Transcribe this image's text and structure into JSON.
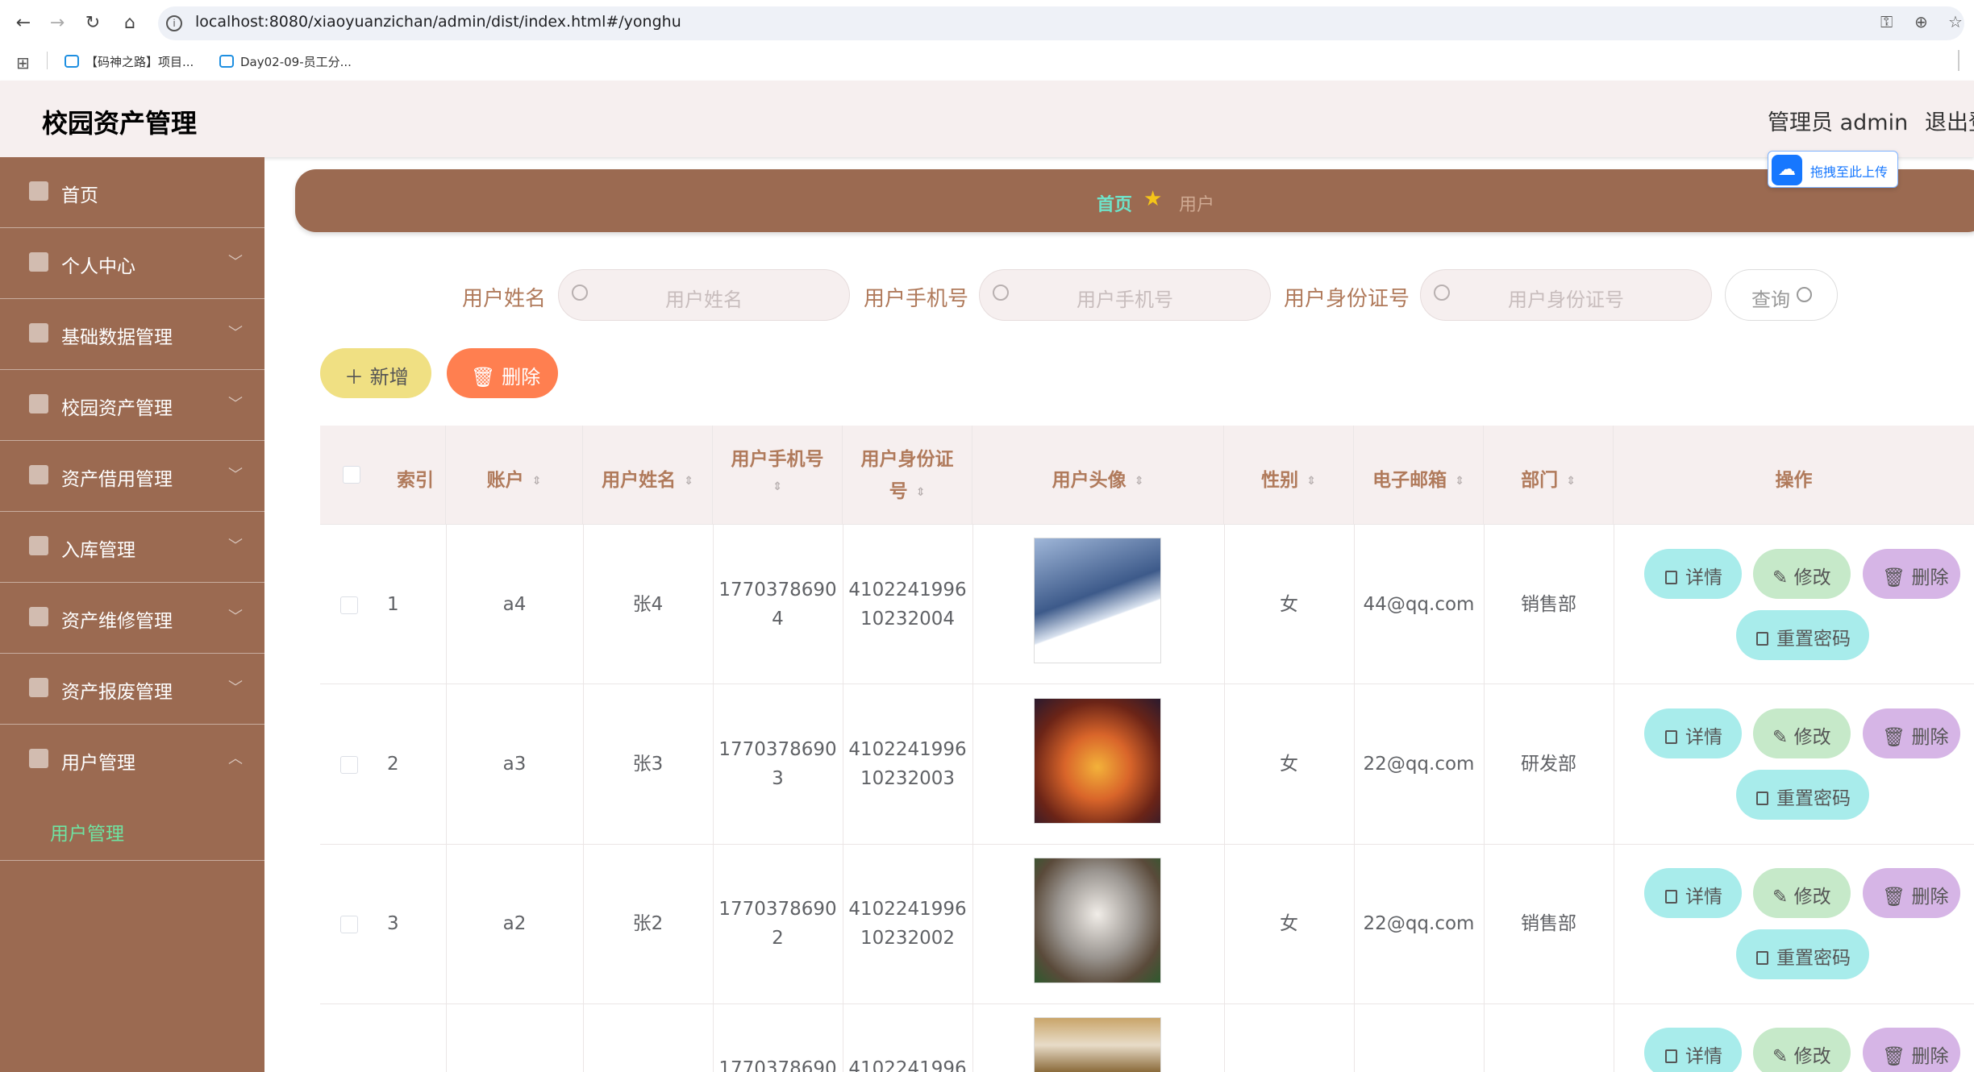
{
  "browser": {
    "url": "localhost:8080/xiaoyuanzichan/admin/dist/index.html#/yonghu",
    "bookmarks": [
      "【码神之路】项目...",
      "Day02-09-员工分..."
    ]
  },
  "header": {
    "title": "校园资产管理",
    "user": "管理员 admin",
    "logout": "退出登录"
  },
  "sidebar": {
    "items": [
      {
        "label": "首页"
      },
      {
        "label": "个人中心"
      },
      {
        "label": "基础数据管理"
      },
      {
        "label": "校园资产管理"
      },
      {
        "label": "资产借用管理"
      },
      {
        "label": "入库管理"
      },
      {
        "label": "资产维修管理"
      },
      {
        "label": "资产报废管理"
      },
      {
        "label": "用户管理"
      }
    ],
    "active_sub": "用户管理"
  },
  "breadcrumb": {
    "home": "首页",
    "current": "用户"
  },
  "upload_chip": "拖拽至此上传",
  "search": {
    "name_label": "用户姓名",
    "name_placeholder": "用户姓名",
    "phone_label": "用户手机号",
    "phone_placeholder": "用户手机号",
    "id_label": "用户身份证号",
    "id_placeholder": "用户身份证号",
    "query": "查询"
  },
  "toolbar": {
    "add": "新增",
    "delete": "删除"
  },
  "table": {
    "headers": {
      "index": "索引",
      "account": "账户",
      "name": "用户姓名",
      "phone_1": "用户手机号",
      "id_1": "用户身份证",
      "id_2": "号",
      "avatar": "用户头像",
      "gender": "性别",
      "email": "电子邮箱",
      "dept": "部门",
      "actions": "操作"
    },
    "rows": [
      {
        "index": "1",
        "account": "a4",
        "name": "张4",
        "phone_1": "1770378690",
        "phone_2": "4",
        "id_1": "4102241996",
        "id_2": "10232004",
        "gender": "女",
        "email": "44@qq.com",
        "dept": "销售部"
      },
      {
        "index": "2",
        "account": "a3",
        "name": "张3",
        "phone_1": "1770378690",
        "phone_2": "3",
        "id_1": "4102241996",
        "id_2": "10232003",
        "gender": "女",
        "email": "22@qq.com",
        "dept": "研发部"
      },
      {
        "index": "3",
        "account": "a2",
        "name": "张2",
        "phone_1": "1770378690",
        "phone_2": "2",
        "id_1": "4102241996",
        "id_2": "10232002",
        "gender": "女",
        "email": "22@qq.com",
        "dept": "销售部"
      },
      {
        "index": "",
        "account": "",
        "name": "",
        "phone_1": "1770378690",
        "phone_2": "",
        "id_1": "4102241996",
        "id_2": "",
        "gender": "",
        "email": "",
        "dept": ""
      }
    ],
    "actions": {
      "detail": "详情",
      "edit": "修改",
      "delete": "删除",
      "reset": "重置密码"
    }
  },
  "colors": {
    "sidebar": "#9b6a51",
    "accent_text": "#b07a5b",
    "detail_btn": "#a8eceb",
    "edit_btn": "#c6e9c9",
    "delete_btn": "#d6b5e6",
    "add_btn": "#f0e083",
    "batch_delete_btn": "#ff7f50"
  }
}
